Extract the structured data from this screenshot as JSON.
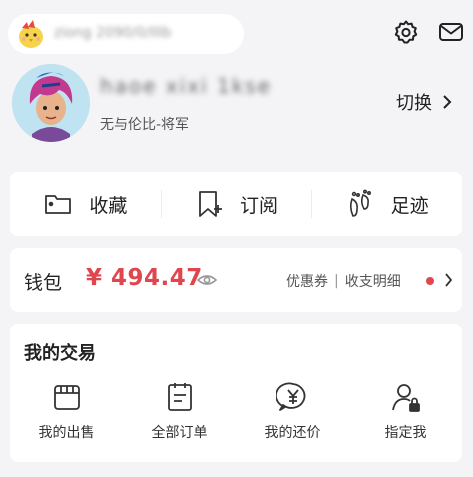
{
  "header": {
    "account_text": "ziong 2090/0/IIIb",
    "username": "haoe xixi 1kse",
    "user_title": "无与伦比-将军",
    "switch_label": "切换",
    "icons": [
      "settings-icon",
      "mail-icon"
    ]
  },
  "quick_actions": [
    {
      "label": "收藏",
      "icon": "folder-icon"
    },
    {
      "label": "订阅",
      "icon": "bookmark-plus-icon"
    },
    {
      "label": "足迹",
      "icon": "footprint-icon"
    }
  ],
  "wallet": {
    "label": "钱包",
    "amount": "¥ 494.47",
    "links": [
      "优惠券",
      "收支明细"
    ],
    "separator": "|",
    "accent_color": "#e0464e"
  },
  "trade": {
    "title": "我的交易",
    "items": [
      {
        "label": "我的出售",
        "icon": "store-icon"
      },
      {
        "label": "全部订单",
        "icon": "order-list-icon"
      },
      {
        "label": "我的还价",
        "icon": "yen-chat-icon"
      },
      {
        "label": "指定我",
        "icon": "user-lock-icon"
      }
    ]
  }
}
